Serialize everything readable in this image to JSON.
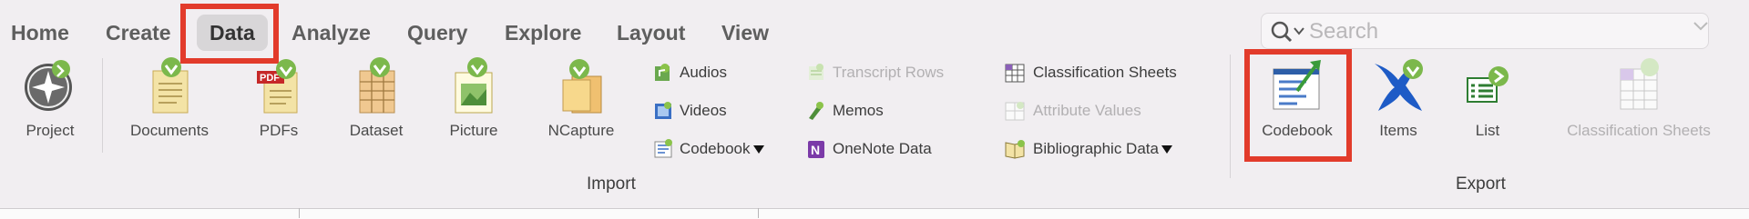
{
  "tabs": [
    "Home",
    "Create",
    "Data",
    "Analyze",
    "Query",
    "Explore",
    "Layout",
    "View"
  ],
  "active_tab": "Data",
  "search": {
    "placeholder": "Search"
  },
  "import": {
    "group_label": "Import",
    "large": [
      {
        "label": "Project",
        "icon": "project-icon"
      },
      {
        "label": "Documents",
        "icon": "documents-icon"
      },
      {
        "label": "PDFs",
        "icon": "pdf-icon"
      },
      {
        "label": "Dataset",
        "icon": "dataset-icon"
      },
      {
        "label": "Picture",
        "icon": "picture-icon"
      },
      {
        "label": "NCapture",
        "icon": "ncapture-icon"
      }
    ],
    "col1": [
      {
        "label": "Audios",
        "icon": "audio-icon",
        "enabled": true
      },
      {
        "label": "Videos",
        "icon": "video-icon",
        "enabled": true
      },
      {
        "label": "Codebook",
        "icon": "codebook-small-icon",
        "enabled": true,
        "dropdown": true
      }
    ],
    "col2": [
      {
        "label": "Transcript Rows",
        "icon": "transcript-rows-icon",
        "enabled": false
      },
      {
        "label": "Memos",
        "icon": "memos-icon",
        "enabled": true
      },
      {
        "label": "OneNote Data",
        "icon": "onenote-icon",
        "enabled": true
      }
    ],
    "col3": [
      {
        "label": "Classification Sheets",
        "icon": "classification-sheets-icon",
        "enabled": true
      },
      {
        "label": "Attribute Values",
        "icon": "attribute-values-icon",
        "enabled": false
      },
      {
        "label": "Bibliographic Data",
        "icon": "bibliographic-data-icon",
        "enabled": true,
        "dropdown": true
      }
    ]
  },
  "export": {
    "group_label": "Export",
    "large": [
      {
        "label": "Codebook",
        "icon": "codebook-export-icon",
        "enabled": true
      },
      {
        "label": "Items",
        "icon": "items-export-icon",
        "enabled": true
      },
      {
        "label": "List",
        "icon": "list-export-icon",
        "enabled": true
      },
      {
        "label": "Classification Sheets",
        "icon": "classification-sheets-export-icon",
        "enabled": false
      }
    ]
  },
  "colors": {
    "highlight": "#e23b2b",
    "active_tab_bg": "#d8d6d8",
    "ribbon_bg": "#f1eef1"
  }
}
